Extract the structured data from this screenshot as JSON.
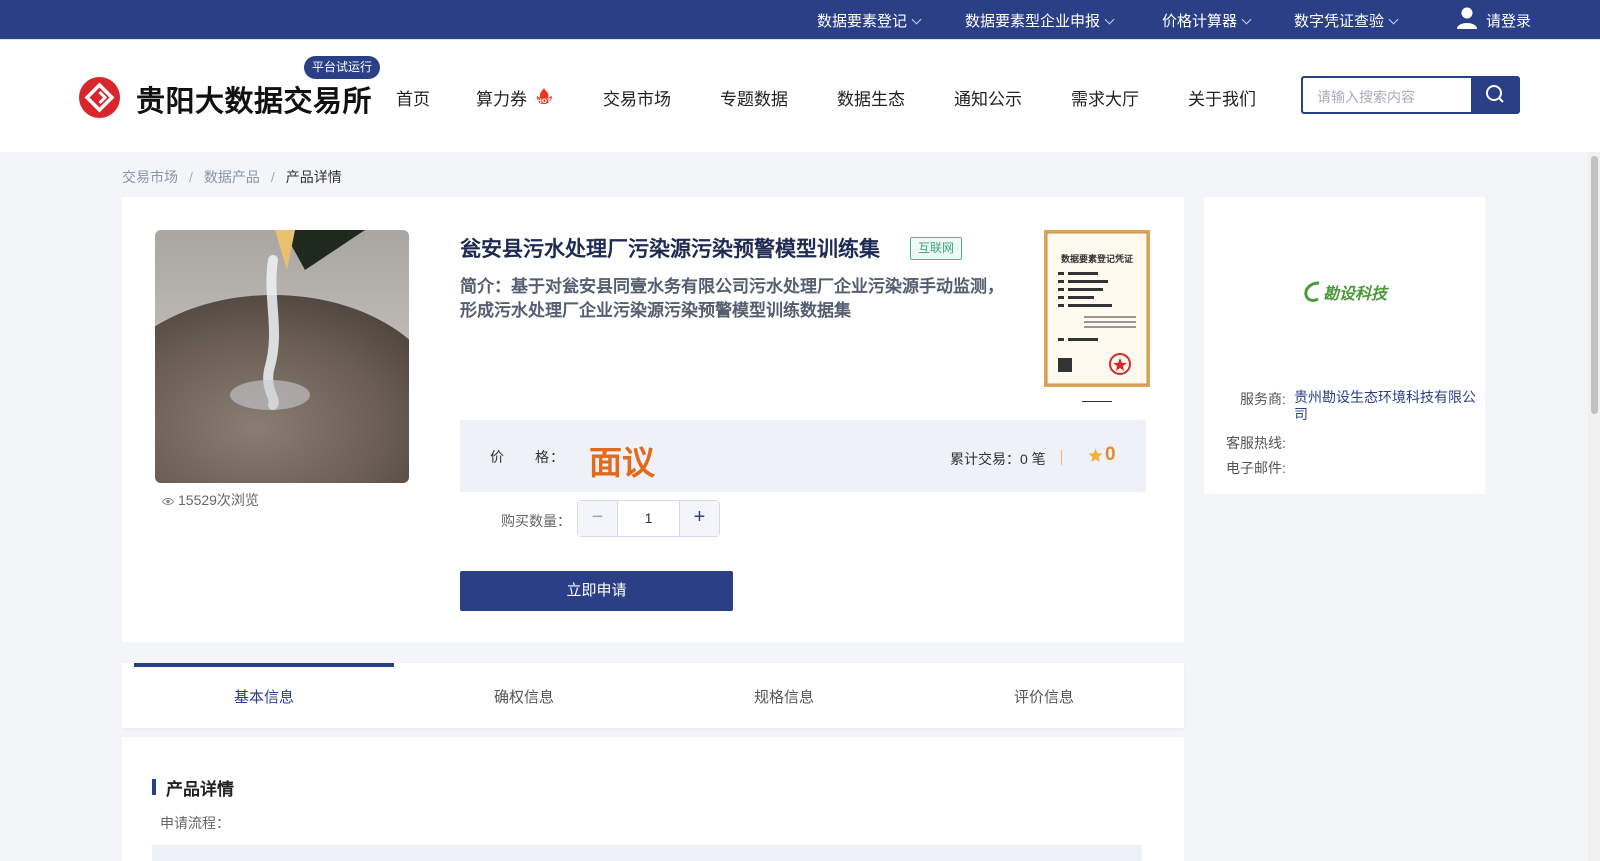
{
  "topbar": {
    "menus": [
      "数据要素登记",
      "数据要素型企业申报",
      "价格计算器",
      "数字凭证查验"
    ],
    "login_label": "请登录"
  },
  "header": {
    "site_name": "贵阳大数据交易所",
    "trial_badge": "平台试运行",
    "nav": [
      "首页",
      "算力券",
      "交易市场",
      "专题数据",
      "数据生态",
      "通知公示",
      "需求大厅",
      "关于我们"
    ],
    "hot_badge": "HOT",
    "search_placeholder": "请输入搜索内容"
  },
  "breadcrumb": [
    "交易市场",
    "数据产品",
    "产品详情"
  ],
  "breadcrumb_separator": "/",
  "product": {
    "title": "瓮安县污水处理厂污染源污染预警模型训练集",
    "tag": "互联网",
    "description": "简介：基于对瓮安县同壹水务有限公司污水处理厂企业污染源手动监测，形成污水处理厂企业污染源污染预警模型训练数据集",
    "views": "15529次浏览",
    "price_label": "价　　格：",
    "price_value": "面议",
    "trade_count": "累计交易：0 笔",
    "rating": "0",
    "quantity_label": "购买数量：",
    "quantity_value": "1",
    "apply_label": "立即申请",
    "certificate_title": "数据要素登记凭证"
  },
  "provider": {
    "logo_text": "勘设科技",
    "service_label": "服务商:",
    "service_value": "贵州勘设生态环境科技有限公司",
    "hotline_label": "客服热线:",
    "email_label": "电子邮件:"
  },
  "tabs": [
    "基本信息",
    "确权信息",
    "规格信息",
    "评价信息"
  ],
  "details": {
    "section_title": "产品详情",
    "flow_label": "申请流程："
  },
  "colors": {
    "primary": "#2b3f86",
    "price": "#e26b1b",
    "tag_green": "#3aa877"
  }
}
